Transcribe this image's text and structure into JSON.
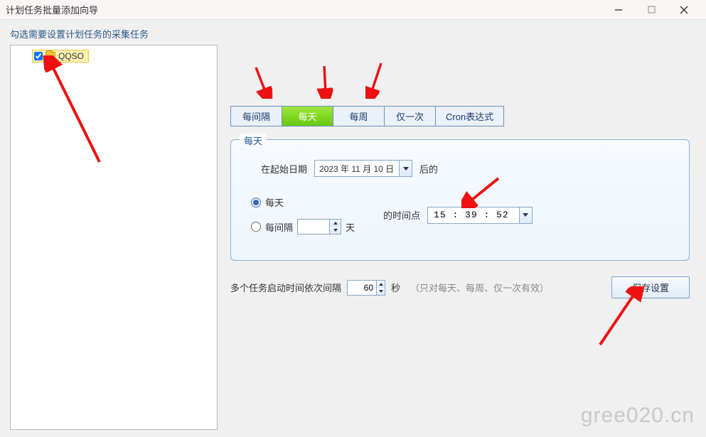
{
  "window": {
    "title": "计划任务批量添加向导"
  },
  "subtitle": "勾选需要设置计划任务的采集任务",
  "tree": {
    "items": [
      {
        "label": "QQSO",
        "checked": true
      }
    ]
  },
  "tabs": {
    "items": [
      {
        "label": "每间隔"
      },
      {
        "label": "每天",
        "active": true
      },
      {
        "label": "每周"
      },
      {
        "label": "仅一次"
      },
      {
        "label": "Cron表达式"
      }
    ]
  },
  "panel": {
    "legend": "每天",
    "start_date_label": "在起始日期",
    "start_date_value": "2023 年 11 月 10 日",
    "after_label": "后的",
    "radio_daily": "每天",
    "radio_interval": "每间隔",
    "interval_value": "",
    "interval_unit": "天",
    "time_label": "的时间点",
    "time_value": "15 : 39 : 52"
  },
  "bottom": {
    "label": "多个任务启动时间依次间隔",
    "value": "60",
    "unit": "秒",
    "hint": "（只对每天、每周、仅一次有效）",
    "save_label": "保存设置"
  },
  "watermark": "gree020.cn"
}
